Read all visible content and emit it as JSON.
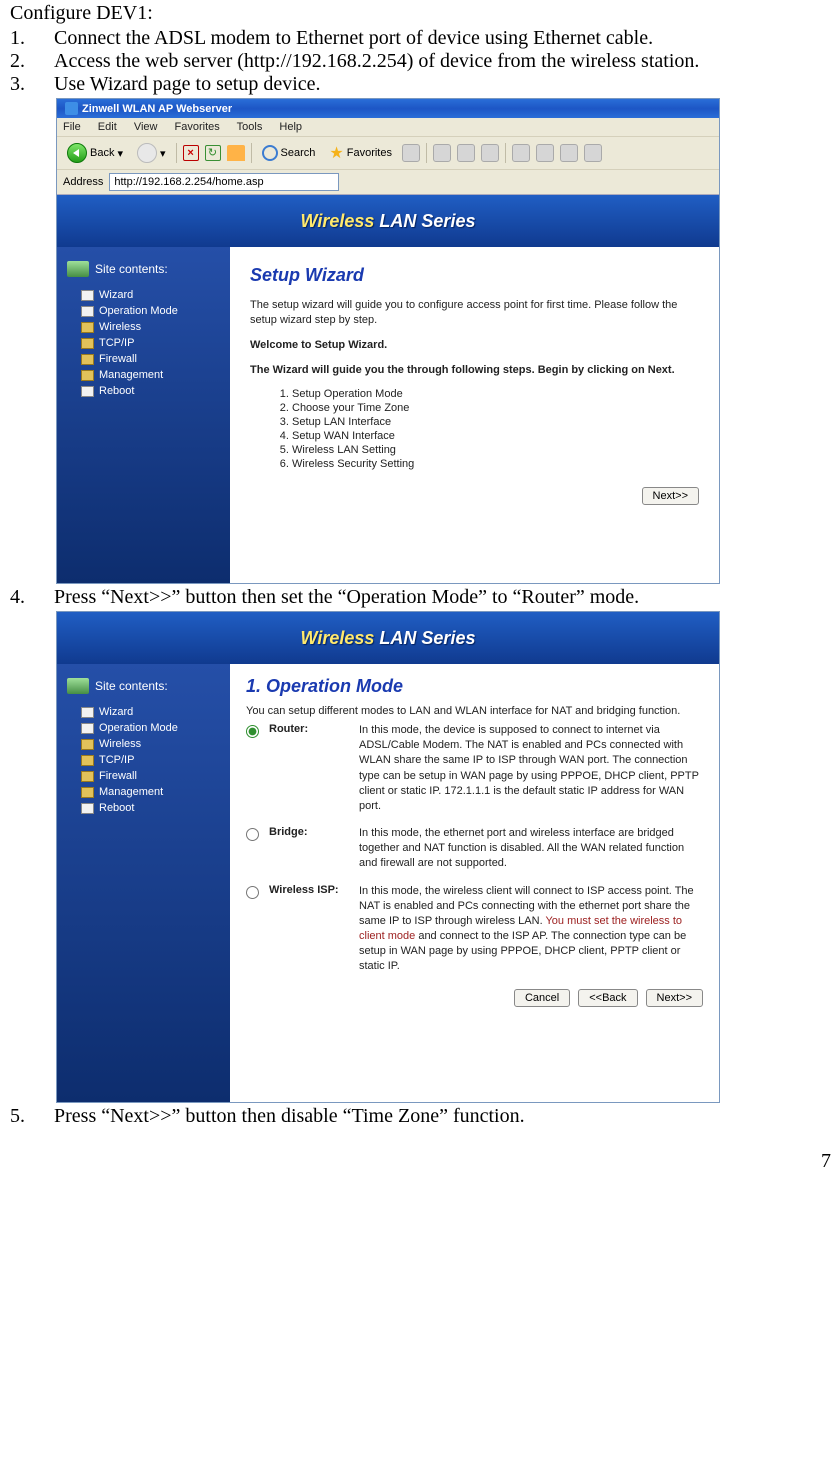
{
  "intro": "Configure DEV1:",
  "steps": {
    "s1": "Connect the ADSL modem to Ethernet port of device using Ethernet cable.",
    "s2": "Access the web server (http://192.168.2.254) of device from the wireless station.",
    "s3": "Use Wizard page to setup device.",
    "s4": "Press “Next>>” button then set the “Operation Mode” to “Router” mode.",
    "s5": "Press “Next>>” button then disable “Time Zone” function."
  },
  "ie": {
    "title": "Zinwell WLAN AP Webserver",
    "menu": {
      "file": "File",
      "edit": "Edit",
      "view": "View",
      "favorites": "Favorites",
      "tools": "Tools",
      "help": "Help"
    },
    "toolbar": {
      "back": "Back",
      "search": "Search",
      "favorites": "Favorites"
    },
    "address_label": "Address",
    "address": "http://192.168.2.254/home.asp"
  },
  "banner": {
    "pre": "Wireless ",
    "post": "LAN Series"
  },
  "sidebar": {
    "heading": "Site contents:",
    "items": {
      "wizard": "Wizard",
      "opmode": "Operation Mode",
      "wireless": "Wireless",
      "tcpip": "TCP/IP",
      "firewall": "Firewall",
      "management": "Management",
      "reboot": "Reboot"
    }
  },
  "wizard": {
    "heading": "Setup Wizard",
    "intro": "The setup wizard will guide you to configure access point for first time. Please follow the setup wizard step by step.",
    "welcome": "Welcome to Setup Wizard.",
    "guide": "The Wizard will guide you the through following steps. Begin by clicking on Next.",
    "steps": {
      "s1": "Setup Operation Mode",
      "s2": "Choose your Time Zone",
      "s3": "Setup LAN Interface",
      "s4": "Setup WAN Interface",
      "s5": "Wireless LAN Setting",
      "s6": "Wireless Security Setting"
    },
    "next": "Next>>"
  },
  "opmode": {
    "heading": "1. Operation Mode",
    "intro": "You can setup different modes to LAN and WLAN interface for NAT and bridging function.",
    "router_label": "Router:",
    "router_desc": "In this mode, the device is supposed to connect to internet via ADSL/Cable Modem. The NAT is enabled and PCs connected with WLAN share the same IP to ISP through WAN port. The connection type can be setup in WAN page by using PPPOE, DHCP client, PPTP client or static IP. 172.1.1.1 is the default static IP address for WAN port.",
    "bridge_label": "Bridge:",
    "bridge_desc": "In this mode, the ethernet port and wireless interface are bridged together and NAT function is disabled. All the WAN related function and firewall are not supported.",
    "wisp_label": "Wireless ISP:",
    "wisp_desc_pre": "In this mode, the wireless client will connect to ISP access point. The NAT is enabled and PCs connecting with the ethernet port share the same IP to ISP through wireless LAN. ",
    "wisp_desc_red": "You must set the wireless to client mode",
    "wisp_desc_post": " and connect to the ISP AP. The connection type can be setup in WAN page by using PPPOE, DHCP client, PPTP client or static IP.",
    "cancel": "Cancel",
    "back": "<<Back",
    "next": "Next>>"
  },
  "page_number": "7"
}
